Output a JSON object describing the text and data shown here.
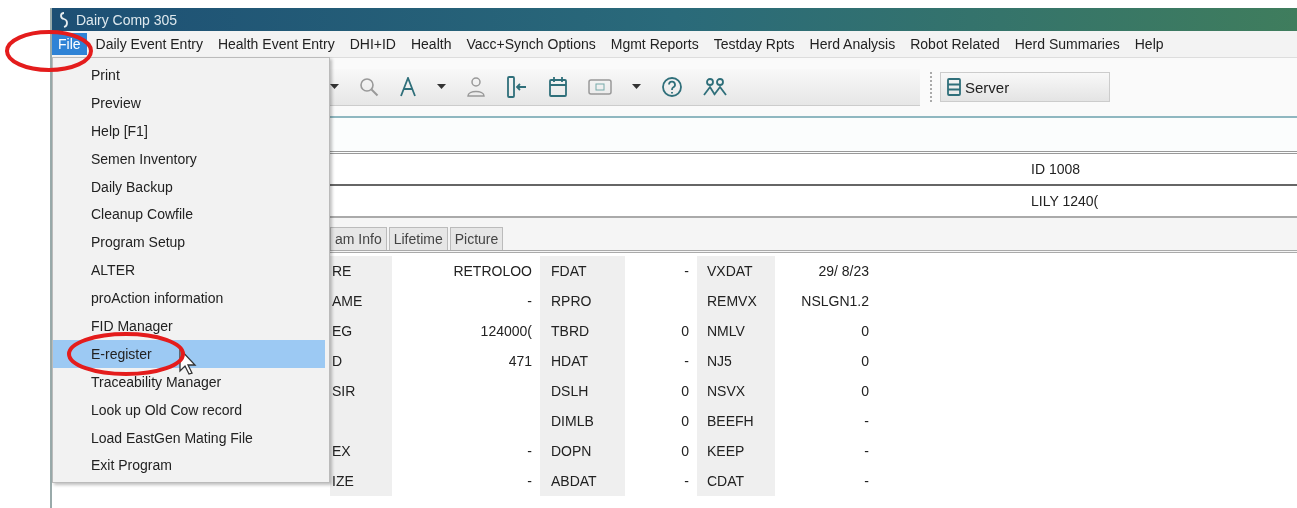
{
  "window": {
    "title": "Dairy Comp 305"
  },
  "menu_bar": [
    {
      "label": "File",
      "selected": true
    },
    {
      "label": "Daily Event Entry",
      "selected": false
    },
    {
      "label": "Health Event Entry",
      "selected": false
    },
    {
      "label": "DHI+ID",
      "selected": false
    },
    {
      "label": "Health",
      "selected": false
    },
    {
      "label": "Vacc+Synch Options",
      "selected": false
    },
    {
      "label": "Mgmt Reports",
      "selected": false
    },
    {
      "label": "Testday Rpts",
      "selected": false
    },
    {
      "label": "Herd Analysis",
      "selected": false
    },
    {
      "label": "Robot Related",
      "selected": false
    },
    {
      "label": "Herd Summaries",
      "selected": false
    },
    {
      "label": "Help",
      "selected": false
    }
  ],
  "file_menu": [
    {
      "label": "Print",
      "selected": false
    },
    {
      "label": "Preview",
      "selected": false
    },
    {
      "label": "Help [F1]",
      "selected": false
    },
    {
      "label": "Semen Inventory",
      "selected": false
    },
    {
      "label": "Daily Backup",
      "selected": false
    },
    {
      "label": "Cleanup Cowfile",
      "selected": false
    },
    {
      "label": "Program Setup",
      "selected": false
    },
    {
      "label": "ALTER",
      "selected": false
    },
    {
      "label": "proAction information",
      "selected": false
    },
    {
      "label": "FID Manager",
      "selected": false
    },
    {
      "label": "E-register",
      "selected": true
    },
    {
      "label": "Traceability Manager",
      "selected": false
    },
    {
      "label": "Look up Old Cow record",
      "selected": false
    },
    {
      "label": "Load EastGen Mating File",
      "selected": false
    },
    {
      "label": "Exit Program",
      "selected": false
    }
  ],
  "toolbar": {
    "server_button": "Server"
  },
  "record": {
    "id_line": "ID 1008",
    "name_line": "LILY 1240("
  },
  "tabs": [
    {
      "label": "am Info",
      "selected": false
    },
    {
      "label": "Lifetime",
      "selected": false
    },
    {
      "label": "Picture",
      "selected": false
    }
  ],
  "fields": [
    {
      "cells": [
        {
          "label": "RE",
          "value": "RETROLOO"
        },
        {
          "label": "FDAT",
          "value": "-"
        },
        {
          "label": "VXDAT",
          "value": "29/ 8/23"
        }
      ]
    },
    {
      "cells": [
        {
          "label": "AME",
          "value": "-"
        },
        {
          "label": "RPRO"
        },
        {
          "label": "REMVX",
          "value": "NSLGN1.2"
        }
      ]
    },
    {
      "cells": [
        {
          "label": "EG",
          "value": "124000("
        },
        {
          "label": "TBRD",
          "value": "0"
        },
        {
          "label": "NMLV",
          "value": "0"
        }
      ]
    },
    {
      "cells": [
        {
          "label": "D",
          "value": "471"
        },
        {
          "label": "HDAT",
          "value": "-"
        },
        {
          "label": "NJ5",
          "value": "0"
        }
      ]
    },
    {
      "cells": [
        {
          "label": "SIR"
        },
        {
          "label": "DSLH",
          "value": "0"
        },
        {
          "label": "NSVX",
          "value": "0"
        }
      ]
    },
    {
      "cells": [
        {},
        {
          "label": "DIMLB",
          "value": "0"
        },
        {
          "label": "BEEFH",
          "value": "-"
        }
      ]
    },
    {
      "cells": [
        {
          "label": "EX",
          "value": "-"
        },
        {
          "label": "DOPN",
          "value": "0"
        },
        {
          "label": "KEEP",
          "value": "-"
        }
      ]
    },
    {
      "cells": [
        {
          "label": "IZE",
          "value": "-"
        },
        {
          "label": "ABDAT",
          "value": "-"
        },
        {
          "label": "CDAT",
          "value": "-"
        }
      ]
    }
  ]
}
